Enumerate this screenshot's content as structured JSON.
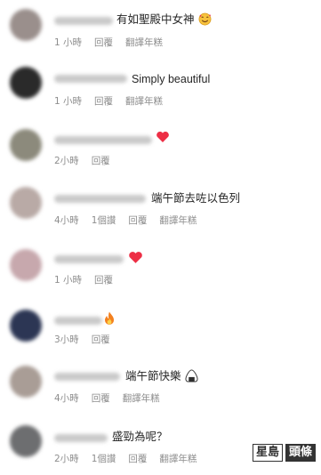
{
  "comments": [
    {
      "text": "有如聖殿中女神",
      "emoji": "smiling-face-with-hearts",
      "time": "1 小時",
      "reply": "回覆",
      "translate": "翻譯年糕",
      "avatar_color": "#9a8f8c"
    },
    {
      "text": "Simply beautiful",
      "time": "1 小時",
      "reply": "回覆",
      "translate": "翻譯年糕",
      "avatar_color": "#2a2a2a"
    },
    {
      "text": "",
      "emoji": "red-heart",
      "time": "2小時",
      "reply": "回覆",
      "avatar_color": "#8c8a7c"
    },
    {
      "text": "端午節去咗以色列",
      "time": "4小時",
      "likes": "1個讚",
      "reply": "回覆",
      "translate": "翻譯年糕",
      "avatar_color": "#b9aaa6"
    },
    {
      "text": "",
      "emoji": "red-heart",
      "time": "1 小時",
      "reply": "回覆",
      "avatar_color": "#c7a8ad"
    },
    {
      "text": "",
      "emoji": "fire",
      "time": "3小時",
      "reply": "回覆",
      "avatar_color": "#2c3654"
    },
    {
      "text": "端午節快樂",
      "emoji": "rice-ball",
      "time": "4小時",
      "reply": "回覆",
      "translate": "翻譯年糕",
      "avatar_color": "#a99d96"
    },
    {
      "text": "盛勁為呢？",
      "time": "2小時",
      "likes": "1個讚",
      "reply": "回覆",
      "translate": "翻譯年糕",
      "avatar_color": "#6d6e70"
    }
  ],
  "watermark": {
    "part1": "星島",
    "part2": "頭條"
  },
  "colors": {
    "text": "#262626",
    "meta": "#8e8e8e",
    "heart": "#ed2e45"
  }
}
